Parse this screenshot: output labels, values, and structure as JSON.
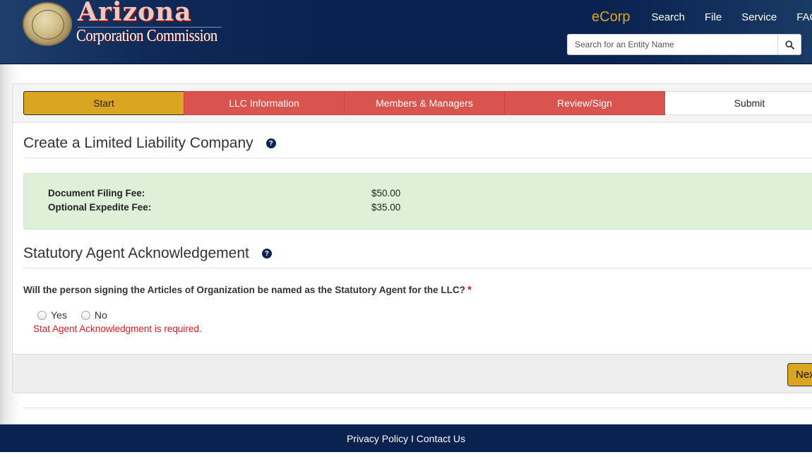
{
  "header": {
    "logo": {
      "title": "Arizona",
      "subtitle": "Corporation Commission",
      "seal_icon": "state-seal"
    },
    "nav": {
      "brand": "eCorp",
      "links": [
        "Search",
        "File",
        "Service",
        "FAQ"
      ]
    },
    "search": {
      "placeholder": "Search for an Entity Name",
      "value": "",
      "button_icon": "magnifier-icon"
    }
  },
  "wizard": {
    "steps": [
      {
        "label": "Start",
        "state": "active"
      },
      {
        "label": "LLC Information",
        "state": "incomplete"
      },
      {
        "label": "Members & Managers",
        "state": "incomplete"
      },
      {
        "label": "Review/Sign",
        "state": "incomplete"
      },
      {
        "label": "Submit",
        "state": "pending"
      }
    ]
  },
  "main": {
    "page_title": "Create a Limited Liability Company",
    "fees": [
      {
        "label": "Document Filing Fee:",
        "amount": "$50.00"
      },
      {
        "label": "Optional Expedite Fee:",
        "amount": "$35.00"
      }
    ],
    "ack_section": {
      "title": "Statutory Agent Acknowledgement",
      "question": "Will the person signing the Articles of Organization be named as the Statutory Agent for the LLC?",
      "required_marker": "*",
      "options": [
        "Yes",
        "No"
      ],
      "selected": null,
      "error": "Stat Agent Acknowledgment is required."
    },
    "next_button": "Next"
  },
  "footer": {
    "privacy": "Privacy Policy",
    "separator": "I",
    "contact": "Contact Us"
  },
  "colors": {
    "navy": "#0a2250",
    "gold": "#daa520",
    "step_red": "#d9534f",
    "fee_green": "#dff0d8",
    "error_red": "#e0191f"
  }
}
